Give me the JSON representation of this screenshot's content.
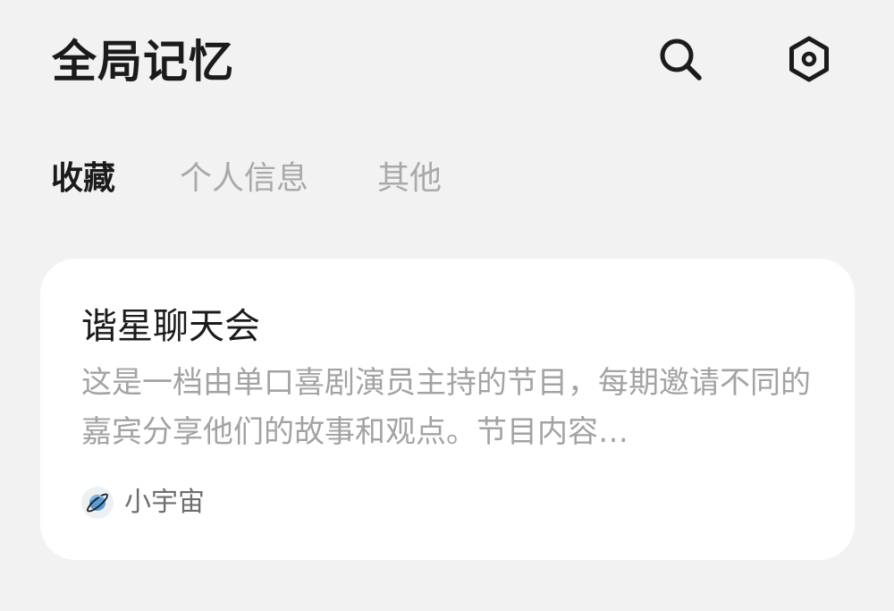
{
  "header": {
    "title": "全局记忆",
    "search_icon": "search-icon",
    "settings_icon": "hexagon-settings-icon"
  },
  "tabs": [
    {
      "label": "收藏",
      "active": true
    },
    {
      "label": "个人信息",
      "active": false
    },
    {
      "label": "其他",
      "active": false
    }
  ],
  "cards": [
    {
      "title": "谐星聊天会",
      "description": "这是一档由单口喜剧演员主持的节目，每期邀请不同的嘉宾分享他们的故事和观点。节目内容…",
      "source": {
        "icon": "planet-icon",
        "name": "小宇宙"
      }
    }
  ],
  "colors": {
    "background": "#f2f2f2",
    "card": "#ffffff",
    "active_tab": "#1b1b1b",
    "inactive_tab": "#a9a9a9",
    "planet_blue": "#5b9bd5"
  }
}
